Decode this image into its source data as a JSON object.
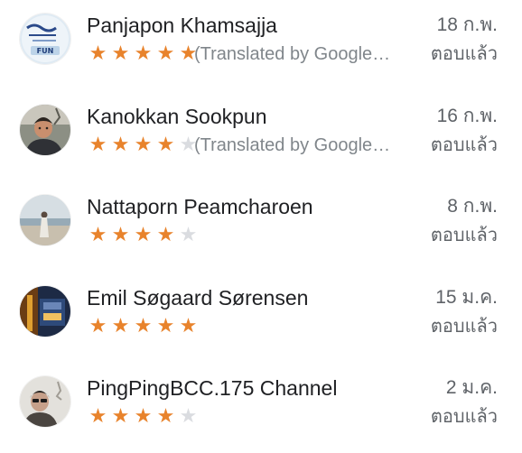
{
  "colors": {
    "star_filled": "#e8832c",
    "star_empty": "#dadce0",
    "name_text": "#202124",
    "secondary_text": "#5f6368"
  },
  "reviews": [
    {
      "name": "Panjapon Khamsajja",
      "rating": 5,
      "snippet": "(Translated by Google…",
      "date": "18 ก.พ.",
      "reply_status": "ตอบแล้ว",
      "avatar_icon": "logo-avatar-icon"
    },
    {
      "name": "Kanokkan Sookpun",
      "rating": 4,
      "snippet": "(Translated by Google…",
      "date": "16 ก.พ.",
      "reply_status": "ตอบแล้ว",
      "avatar_icon": "person-photo-avatar-icon"
    },
    {
      "name": "Nattaporn Peamcharoen",
      "rating": 4,
      "snippet": "",
      "date": "8 ก.พ.",
      "reply_status": "ตอบแล้ว",
      "avatar_icon": "beach-photo-avatar-icon"
    },
    {
      "name": "Emil Søgaard Sørensen",
      "rating": 5,
      "snippet": "",
      "date": "15 ม.ค.",
      "reply_status": "ตอบแล้ว",
      "avatar_icon": "night-scene-avatar-icon"
    },
    {
      "name": "PingPingBCC.175 Channel",
      "rating": 4,
      "snippet": "",
      "date": "2 ม.ค.",
      "reply_status": "ตอบแล้ว",
      "avatar_icon": "person-photo-avatar-icon"
    }
  ]
}
